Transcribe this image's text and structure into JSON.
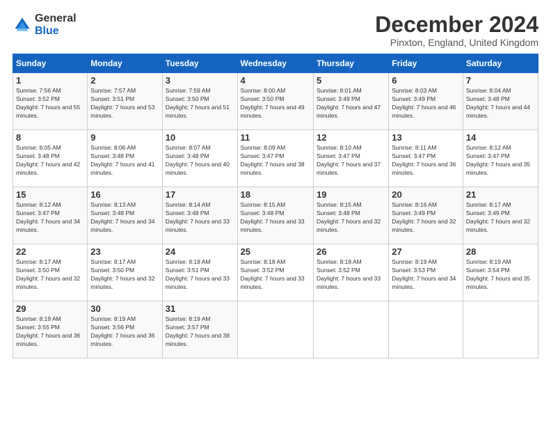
{
  "logo": {
    "general": "General",
    "blue": "Blue"
  },
  "title": "December 2024",
  "subtitle": "Pinxton, England, United Kingdom",
  "headers": [
    "Sunday",
    "Monday",
    "Tuesday",
    "Wednesday",
    "Thursday",
    "Friday",
    "Saturday"
  ],
  "weeks": [
    [
      {
        "day": "1",
        "sunrise": "7:56 AM",
        "sunset": "3:52 PM",
        "daylight": "7 hours and 55 minutes."
      },
      {
        "day": "2",
        "sunrise": "7:57 AM",
        "sunset": "3:51 PM",
        "daylight": "7 hours and 53 minutes."
      },
      {
        "day": "3",
        "sunrise": "7:59 AM",
        "sunset": "3:50 PM",
        "daylight": "7 hours and 51 minutes."
      },
      {
        "day": "4",
        "sunrise": "8:00 AM",
        "sunset": "3:50 PM",
        "daylight": "7 hours and 49 minutes."
      },
      {
        "day": "5",
        "sunrise": "8:01 AM",
        "sunset": "3:49 PM",
        "daylight": "7 hours and 47 minutes."
      },
      {
        "day": "6",
        "sunrise": "8:03 AM",
        "sunset": "3:49 PM",
        "daylight": "7 hours and 46 minutes."
      },
      {
        "day": "7",
        "sunrise": "8:04 AM",
        "sunset": "3:48 PM",
        "daylight": "7 hours and 44 minutes."
      }
    ],
    [
      {
        "day": "8",
        "sunrise": "8:05 AM",
        "sunset": "3:48 PM",
        "daylight": "7 hours and 42 minutes."
      },
      {
        "day": "9",
        "sunrise": "8:06 AM",
        "sunset": "3:48 PM",
        "daylight": "7 hours and 41 minutes."
      },
      {
        "day": "10",
        "sunrise": "8:07 AM",
        "sunset": "3:48 PM",
        "daylight": "7 hours and 40 minutes."
      },
      {
        "day": "11",
        "sunrise": "8:09 AM",
        "sunset": "3:47 PM",
        "daylight": "7 hours and 38 minutes."
      },
      {
        "day": "12",
        "sunrise": "8:10 AM",
        "sunset": "3:47 PM",
        "daylight": "7 hours and 37 minutes."
      },
      {
        "day": "13",
        "sunrise": "8:11 AM",
        "sunset": "3:47 PM",
        "daylight": "7 hours and 36 minutes."
      },
      {
        "day": "14",
        "sunrise": "8:12 AM",
        "sunset": "3:47 PM",
        "daylight": "7 hours and 35 minutes."
      }
    ],
    [
      {
        "day": "15",
        "sunrise": "8:12 AM",
        "sunset": "3:47 PM",
        "daylight": "7 hours and 34 minutes."
      },
      {
        "day": "16",
        "sunrise": "8:13 AM",
        "sunset": "3:48 PM",
        "daylight": "7 hours and 34 minutes."
      },
      {
        "day": "17",
        "sunrise": "8:14 AM",
        "sunset": "3:48 PM",
        "daylight": "7 hours and 33 minutes."
      },
      {
        "day": "18",
        "sunrise": "8:15 AM",
        "sunset": "3:48 PM",
        "daylight": "7 hours and 33 minutes."
      },
      {
        "day": "19",
        "sunrise": "8:15 AM",
        "sunset": "3:48 PM",
        "daylight": "7 hours and 32 minutes."
      },
      {
        "day": "20",
        "sunrise": "8:16 AM",
        "sunset": "3:49 PM",
        "daylight": "7 hours and 32 minutes."
      },
      {
        "day": "21",
        "sunrise": "8:17 AM",
        "sunset": "3:49 PM",
        "daylight": "7 hours and 32 minutes."
      }
    ],
    [
      {
        "day": "22",
        "sunrise": "8:17 AM",
        "sunset": "3:50 PM",
        "daylight": "7 hours and 32 minutes."
      },
      {
        "day": "23",
        "sunrise": "8:17 AM",
        "sunset": "3:50 PM",
        "daylight": "7 hours and 32 minutes."
      },
      {
        "day": "24",
        "sunrise": "8:18 AM",
        "sunset": "3:51 PM",
        "daylight": "7 hours and 33 minutes."
      },
      {
        "day": "25",
        "sunrise": "8:18 AM",
        "sunset": "3:52 PM",
        "daylight": "7 hours and 33 minutes."
      },
      {
        "day": "26",
        "sunrise": "8:18 AM",
        "sunset": "3:52 PM",
        "daylight": "7 hours and 33 minutes."
      },
      {
        "day": "27",
        "sunrise": "8:19 AM",
        "sunset": "3:53 PM",
        "daylight": "7 hours and 34 minutes."
      },
      {
        "day": "28",
        "sunrise": "8:19 AM",
        "sunset": "3:54 PM",
        "daylight": "7 hours and 35 minutes."
      }
    ],
    [
      {
        "day": "29",
        "sunrise": "8:19 AM",
        "sunset": "3:55 PM",
        "daylight": "7 hours and 36 minutes."
      },
      {
        "day": "30",
        "sunrise": "8:19 AM",
        "sunset": "3:56 PM",
        "daylight": "7 hours and 36 minutes."
      },
      {
        "day": "31",
        "sunrise": "8:19 AM",
        "sunset": "3:57 PM",
        "daylight": "7 hours and 38 minutes."
      },
      null,
      null,
      null,
      null
    ]
  ]
}
